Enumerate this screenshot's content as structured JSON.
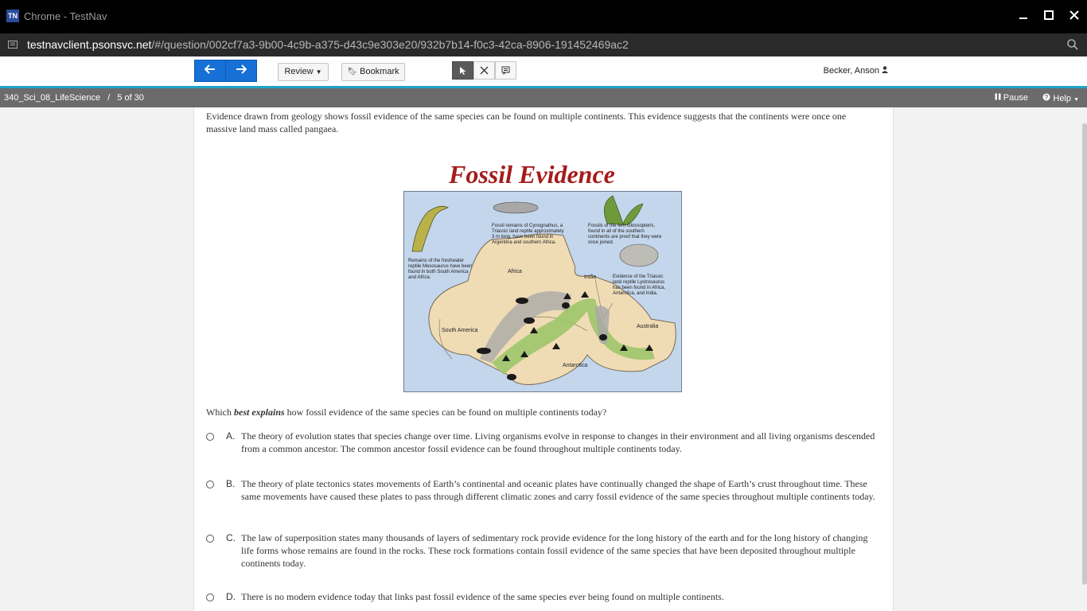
{
  "window": {
    "app_logo": "TN",
    "title": "Chrome - TestNav",
    "minimize_icon": "minimize-icon",
    "maximize_icon": "maximize-icon",
    "close_icon": "close-icon"
  },
  "address": {
    "host": "testnavclient.psonsvc.net",
    "path": "/#/question/002cf7a3-9b00-4c9b-a375-d43c9e303e20/932b7b14-f0c3-42ca-8906-191452469ac2"
  },
  "toolbar": {
    "review_label": "Review",
    "bookmark_label": "Bookmark",
    "user_name": "Becker, Anson"
  },
  "status": {
    "test_name": "340_Sci_08_LifeScience",
    "position": "5 of 30",
    "pause_label": "Pause",
    "help_label": "Help"
  },
  "question": {
    "passage": "Evidence drawn from geology shows fossil evidence of the same species can be found on multiple continents. This evidence suggests that the continents were once one massive land mass called pangaea.",
    "figure_title": "Fossil Evidence",
    "map": {
      "note_mesosaurus": [
        "Remains of the freshwater",
        "reptile Mesosaurus have been",
        "found in both South America",
        "and Africa."
      ],
      "note_cynognathus": [
        "Fossil remains of Cynognathus, a",
        "Triassic land reptile approximately",
        "3 m long, have been found in",
        "Argentina and southern Africa."
      ],
      "note_glossopteris": [
        "Fossils of the fern Glossopteris,",
        "found in all of the southern",
        "continents are proof that they were",
        "once joined."
      ],
      "note_lystrosaurus": [
        "Evidence of the Triassic",
        "land reptile Lystrosaurus",
        "has been found in Africa,",
        "Antarctica, and India."
      ],
      "label_africa": "Africa",
      "label_india": "India",
      "label_south_america": "South America",
      "label_australia": "Australia",
      "label_antarctica": "Antarctica"
    },
    "prompt_pre": "Which ",
    "prompt_em": "best explains",
    "prompt_post": " how fossil evidence of the same species can be found on multiple continents today?",
    "choices": [
      {
        "letter": "A.",
        "text": "The theory of evolution states that species change over time. Living organisms evolve in response to changes in their environment and all living organisms descended from a common ancestor. The common ancestor fossil evidence can be found throughout multiple continents today."
      },
      {
        "letter": "B.",
        "text": "The theory of plate tectonics states movements of Earth’s continental and oceanic plates have continually changed the shape of Earth’s crust throughout time. These same movements have caused these plates to pass through different climatic zones and carry fossil evidence of the same species throughout multiple continents today."
      },
      {
        "letter": "C.",
        "text": "The law of superposition states many thousands of layers of sedimentary rock provide evidence for the long history of the earth and for the long history of changing life forms whose remains are found in the rocks. These rock formations contain fossil evidence of the same species that have been deposited throughout multiple continents today."
      },
      {
        "letter": "D.",
        "text": "There is no modern evidence today that links past fossil evidence of the same species ever being found on multiple continents."
      }
    ]
  }
}
